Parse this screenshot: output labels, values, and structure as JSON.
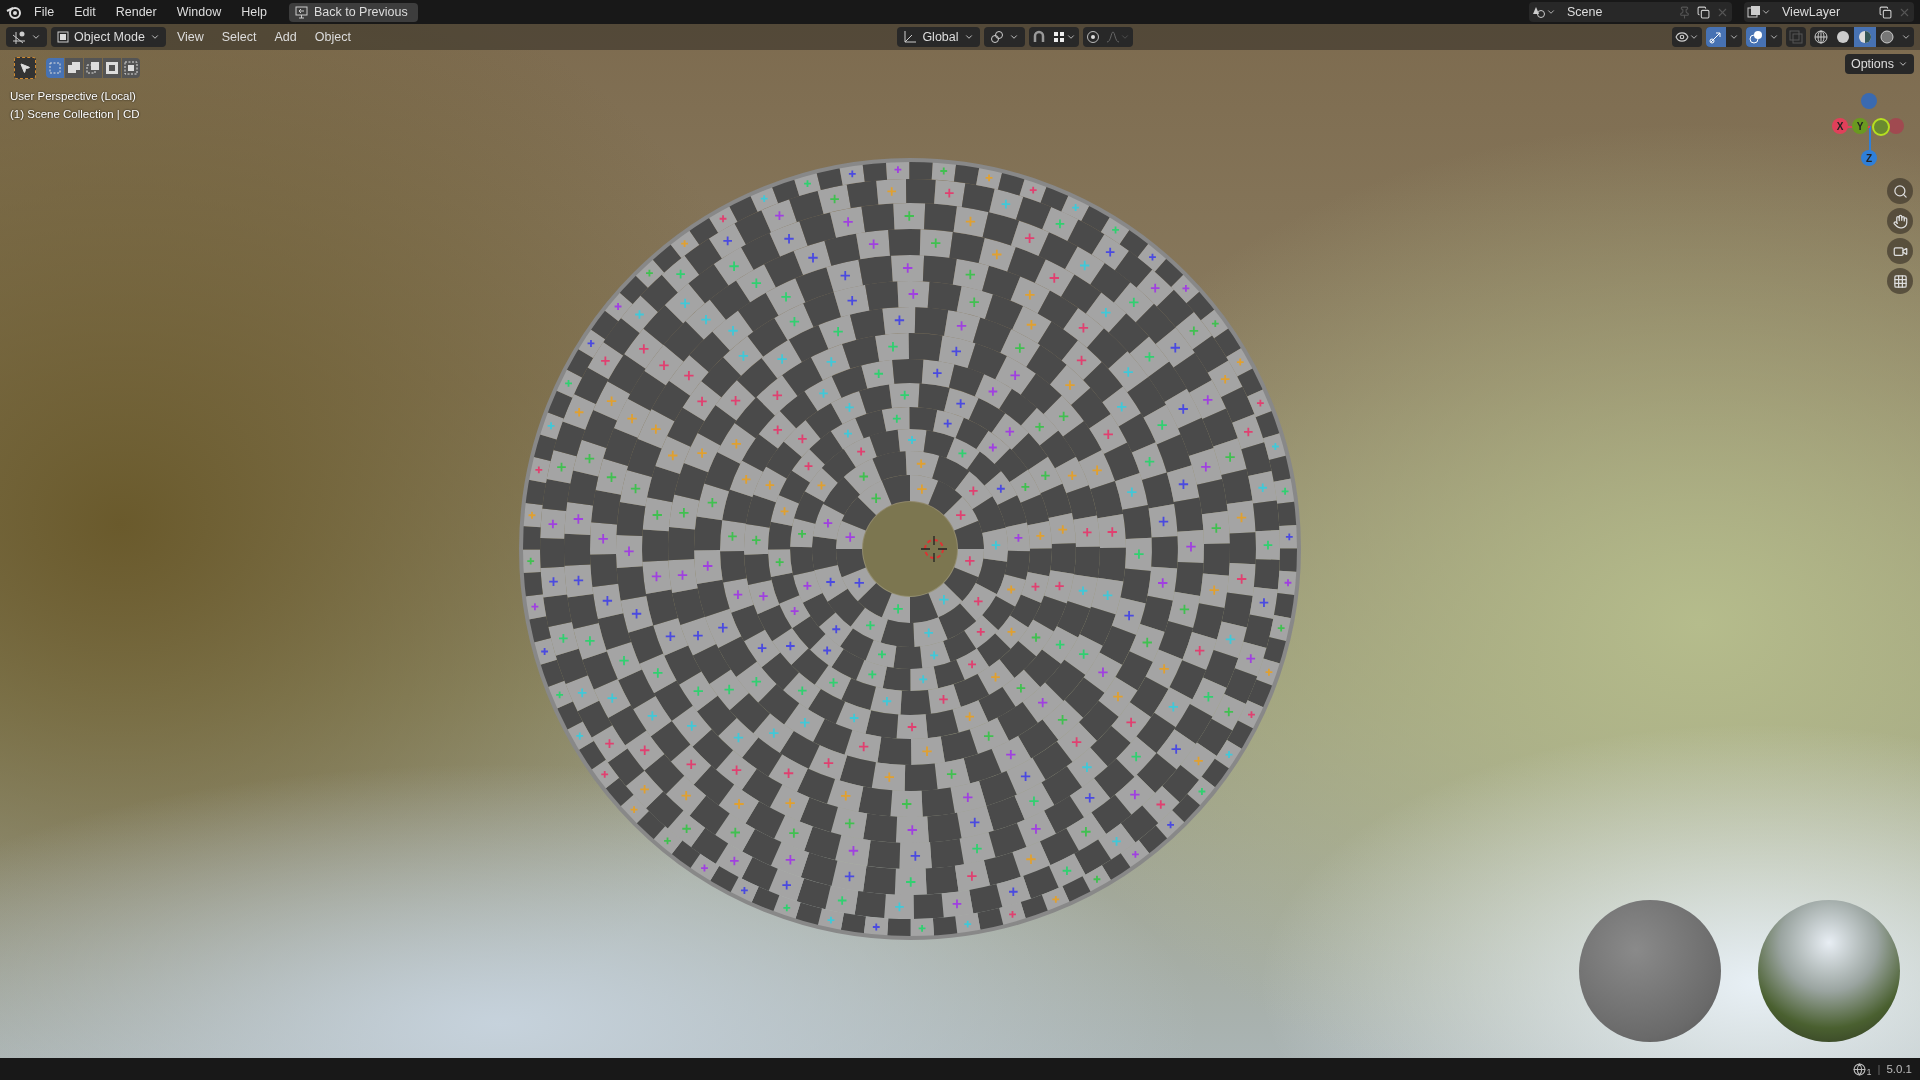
{
  "top_bar": {
    "menus": [
      "File",
      "Edit",
      "Render",
      "Window",
      "Help"
    ],
    "back_button": "Back to Previous",
    "scene": "Scene",
    "view_layer": "ViewLayer"
  },
  "header": {
    "mode": "Object Mode",
    "menus": [
      "View",
      "Select",
      "Add",
      "Object"
    ],
    "orientation": "Global",
    "snap": {
      "on": false
    },
    "proportional": {
      "on": false
    },
    "overlays": {
      "on": true
    },
    "gizmos": {
      "on": true
    },
    "xray": {
      "on": false
    },
    "shading": [
      {
        "kind": "wireframe",
        "selected": false
      },
      {
        "kind": "solid",
        "selected": false
      },
      {
        "kind": "material",
        "selected": true
      },
      {
        "kind": "rendered",
        "selected": false
      }
    ]
  },
  "toolbar": {
    "select_modes": [
      {
        "kind": "set",
        "selected": true
      },
      {
        "kind": "extend",
        "selected": false
      },
      {
        "kind": "subtract",
        "selected": false
      },
      {
        "kind": "invert",
        "selected": false
      },
      {
        "kind": "intersect",
        "selected": false
      }
    ]
  },
  "options": "Options",
  "viewport": {
    "info": [
      "User Perspective (Local)",
      "(1) Scene Collection | CD"
    ],
    "gizmo_axes": [
      {
        "label": "X",
        "color": "#e0405a"
      },
      {
        "label": "Y",
        "color": "#6a9a20"
      },
      {
        "label": "Z",
        "color": "#2f7fd8"
      }
    ]
  },
  "status_bar": {
    "badge": "1",
    "separator": "|",
    "version": "5.0.1"
  }
}
